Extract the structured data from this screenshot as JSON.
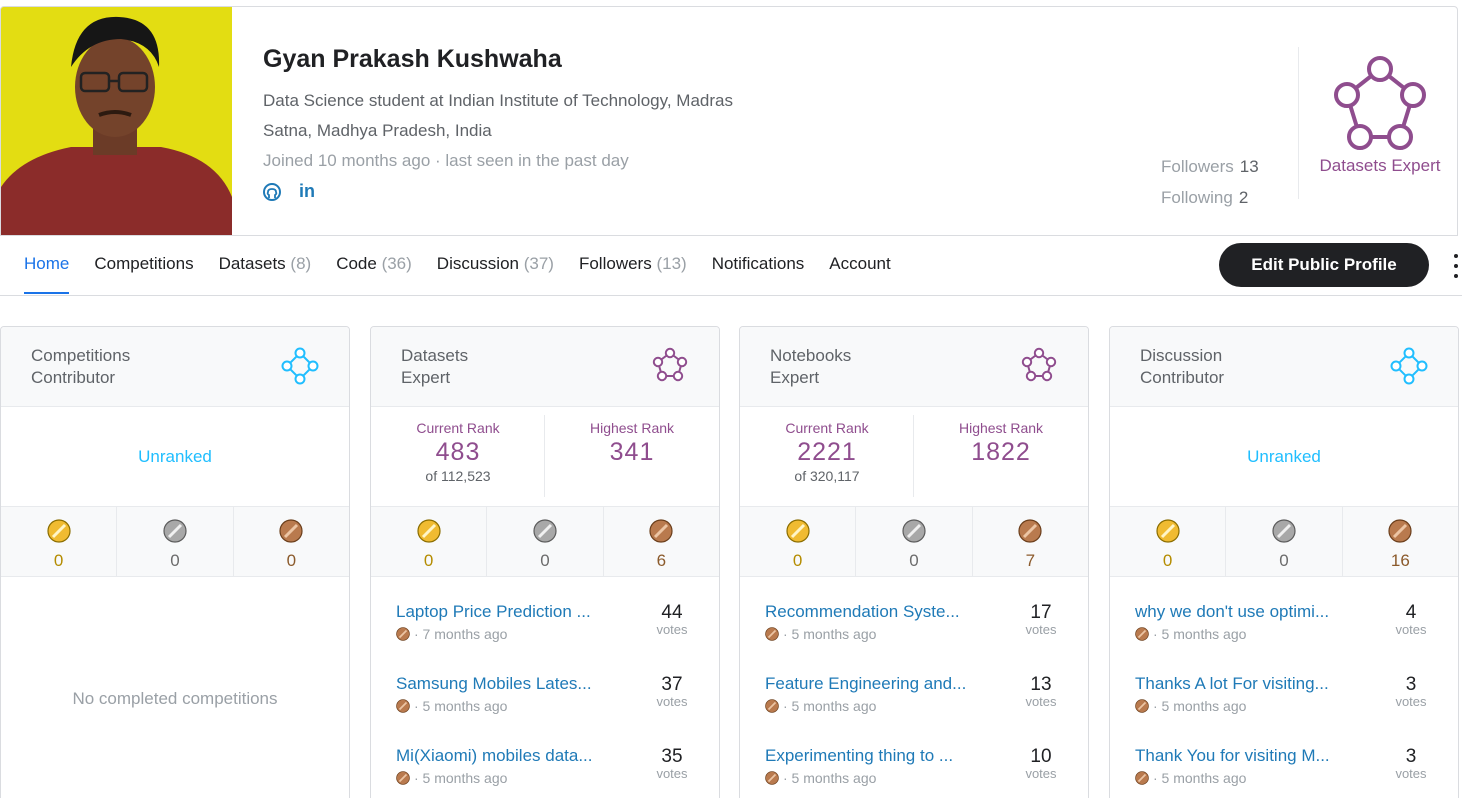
{
  "profile": {
    "name": "Gyan Prakash Kushwaha",
    "bio": "Data Science student at Indian Institute of Technology, Madras",
    "location": "Satna, Madhya Pradesh, India",
    "joined": "Joined 10 months ago · last seen in the past day",
    "followers_label": "Followers",
    "followers_count": "13",
    "following_label": "Following",
    "following_count": "2",
    "tier": "Datasets Expert",
    "social": [
      "github-icon",
      "linkedin-icon"
    ]
  },
  "nav": {
    "tabs": [
      {
        "label": "Home",
        "count": ""
      },
      {
        "label": "Competitions",
        "count": ""
      },
      {
        "label": "Datasets",
        "count": "(8)"
      },
      {
        "label": "Code",
        "count": "(36)"
      },
      {
        "label": "Discussion",
        "count": "(37)"
      },
      {
        "label": "Followers",
        "count": "(13)"
      },
      {
        "label": "Notifications",
        "count": ""
      },
      {
        "label": "Account",
        "count": ""
      }
    ],
    "edit_button": "Edit Public Profile"
  },
  "cards": [
    {
      "title_line1": "Competitions",
      "title_line2": "Contributor",
      "unranked": "Unranked",
      "medals": {
        "gold": "0",
        "silver": "0",
        "bronze": "0"
      },
      "empty": "No completed competitions"
    },
    {
      "title_line1": "Datasets",
      "title_line2": "Expert",
      "current_label": "Current Rank",
      "current_rank": "483",
      "of_total": "of 112,523",
      "highest_label": "Highest Rank",
      "highest_rank": "341",
      "medals": {
        "gold": "0",
        "silver": "0",
        "bronze": "6"
      },
      "items": [
        {
          "title": "Laptop Price Prediction ...",
          "meta": "· 7 months ago",
          "votes": "44",
          "votes_label": "votes"
        },
        {
          "title": "Samsung Mobiles Lates...",
          "meta": "· 5 months ago",
          "votes": "37",
          "votes_label": "votes"
        },
        {
          "title": "Mi(Xiaomi) mobiles data...",
          "meta": "· 5 months ago",
          "votes": "35",
          "votes_label": "votes"
        }
      ]
    },
    {
      "title_line1": "Notebooks",
      "title_line2": "Expert",
      "current_label": "Current Rank",
      "current_rank": "2221",
      "of_total": "of 320,117",
      "highest_label": "Highest Rank",
      "highest_rank": "1822",
      "medals": {
        "gold": "0",
        "silver": "0",
        "bronze": "7"
      },
      "items": [
        {
          "title": "Recommendation Syste...",
          "meta": "· 5 months ago",
          "votes": "17",
          "votes_label": "votes"
        },
        {
          "title": "Feature Engineering and...",
          "meta": "· 5 months ago",
          "votes": "13",
          "votes_label": "votes"
        },
        {
          "title": "Experimenting thing to ...",
          "meta": "· 5 months ago",
          "votes": "10",
          "votes_label": "votes"
        }
      ]
    },
    {
      "title_line1": "Discussion",
      "title_line2": "Contributor",
      "unranked": "Unranked",
      "medals": {
        "gold": "0",
        "silver": "0",
        "bronze": "16"
      },
      "items": [
        {
          "title": "why we don't use optimi...",
          "meta": "· 5 months ago",
          "votes": "4",
          "votes_label": "votes"
        },
        {
          "title": "Thanks A lot For visiting...",
          "meta": "· 5 months ago",
          "votes": "3",
          "votes_label": "votes"
        },
        {
          "title": "Thank You for visiting M...",
          "meta": "· 5 months ago",
          "votes": "3",
          "votes_label": "votes"
        }
      ]
    }
  ],
  "colors": {
    "expert": "#8f4d8e",
    "contributor": "#20beff",
    "link": "#1f7ab7",
    "active_tab": "#1a73e8",
    "gold": "#f0bb31",
    "silver": "#a8a8a8",
    "bronze": "#c0855a"
  }
}
